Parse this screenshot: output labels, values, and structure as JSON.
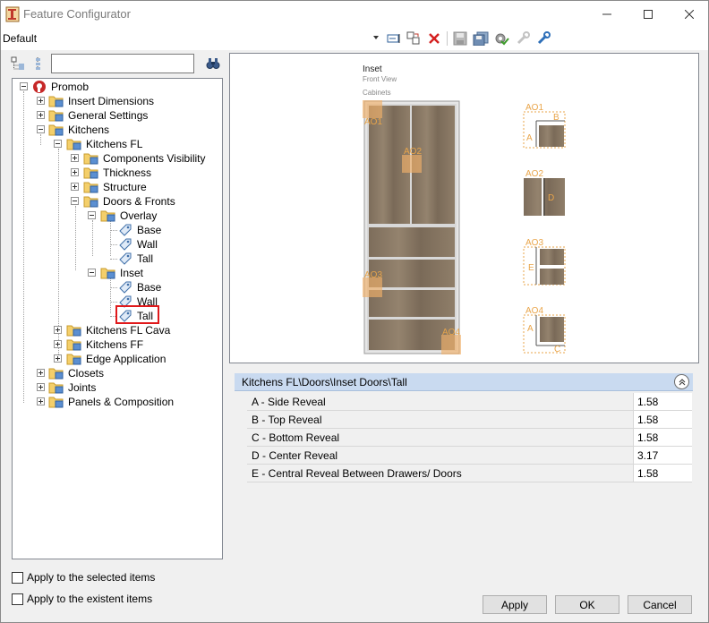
{
  "window": {
    "title": "Feature Configurator"
  },
  "toolbar": {
    "preset_value": "Default"
  },
  "tree": {
    "items": [
      {
        "label": "Promob"
      },
      {
        "label": "Insert Dimensions"
      },
      {
        "label": "General Settings"
      },
      {
        "label": "Kitchens"
      },
      {
        "label": "Kitchens FL"
      },
      {
        "label": "Components Visibility"
      },
      {
        "label": "Thickness"
      },
      {
        "label": "Structure"
      },
      {
        "label": "Doors & Fronts"
      },
      {
        "label": "Overlay"
      },
      {
        "label": "Base"
      },
      {
        "label": "Wall"
      },
      {
        "label": "Tall"
      },
      {
        "label": "Inset"
      },
      {
        "label": "Base"
      },
      {
        "label": "Wall"
      },
      {
        "label": "Tall"
      },
      {
        "label": "Kitchens FL Cava"
      },
      {
        "label": "Kitchens FF"
      },
      {
        "label": "Edge Application"
      },
      {
        "label": "Closets"
      },
      {
        "label": "Joints"
      },
      {
        "label": "Panels & Composition"
      }
    ]
  },
  "options": {
    "apply_selected": "Apply to the selected items",
    "apply_existent": "Apply to the existent items"
  },
  "preview": {
    "title": "Inset",
    "subtitle": "Front View",
    "section": "Cabinets",
    "markers": [
      "AO1",
      "AO2",
      "AO3",
      "AO4"
    ],
    "detail_letters": [
      "B",
      "A",
      "D",
      "E",
      "A",
      "C"
    ]
  },
  "properties": {
    "path": "Kitchens FL\\Doors\\Inset Doors\\Tall",
    "rows": [
      {
        "name": "A - Side Reveal",
        "value": "1.58"
      },
      {
        "name": "B - Top Reveal",
        "value": "1.58"
      },
      {
        "name": "C - Bottom Reveal",
        "value": "1.58"
      },
      {
        "name": "D - Center Reveal",
        "value": "3.17"
      },
      {
        "name": "E - Central Reveal Between Drawers/ Doors",
        "value": "1.58"
      }
    ]
  },
  "buttons": {
    "apply": "Apply",
    "ok": "OK",
    "cancel": "Cancel"
  },
  "colors": {
    "header_bg": "#c9daf0",
    "highlight": "#e0191b",
    "marker": "#e9a54a",
    "wood": "#8a7a66"
  }
}
